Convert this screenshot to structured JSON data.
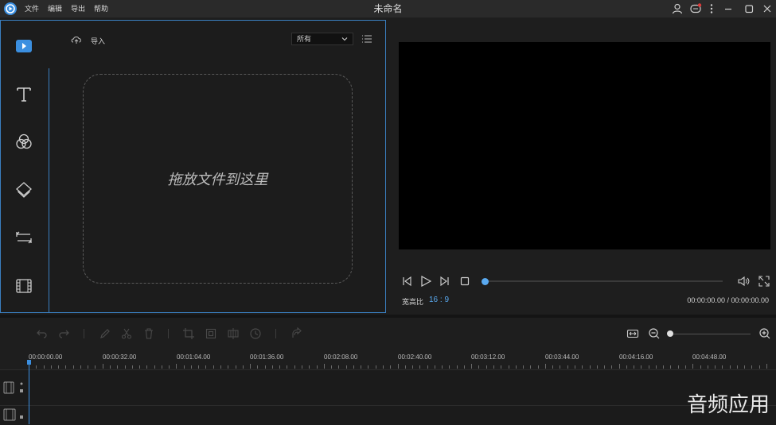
{
  "menubar": {
    "items": [
      "文件",
      "编辑",
      "导出",
      "帮助"
    ]
  },
  "window": {
    "title": "未命名"
  },
  "media_panel": {
    "import_label": "导入",
    "filter_value": "所有",
    "drop_text": "拖放文件到这里"
  },
  "player": {
    "aspect_label": "宽高比",
    "aspect_value": "16 : 9",
    "timecode": "00:00:00.00 / 00:00:00.00",
    "progress": 0
  },
  "timeline": {
    "ruler_labels": [
      "00:00:00.00",
      "00:00:32.00",
      "00:01:04.00",
      "00:01:36.00",
      "00:02:08.00",
      "00:02:40.00",
      "00:03:12.00",
      "00:03:44.00",
      "00:04:16.00",
      "00:04:48.00"
    ]
  },
  "watermark": "音频应用",
  "colors": {
    "accent": "#3b8fe0",
    "panel_border": "#3a7fc0",
    "background": "#1e1e1e"
  }
}
